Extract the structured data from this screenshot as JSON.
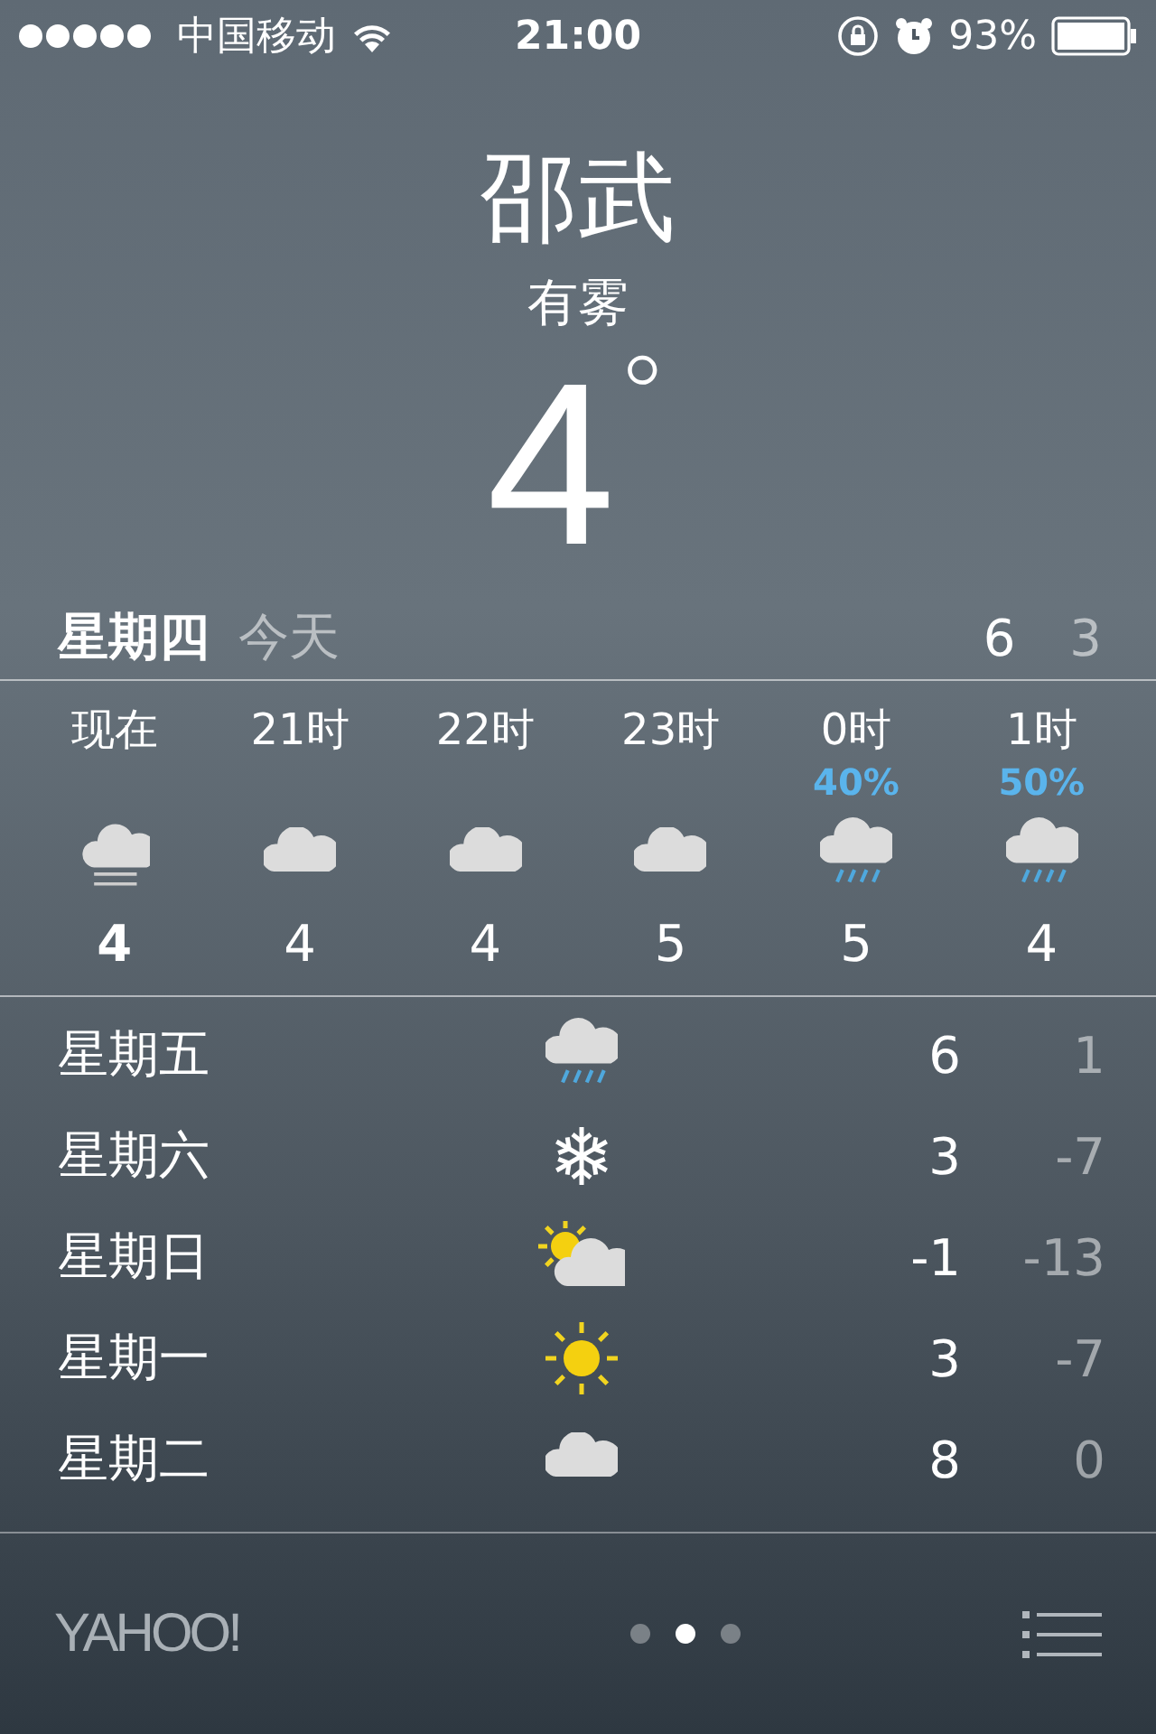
{
  "status_bar": {
    "carrier": "中国移动",
    "time": "21:00",
    "battery": "93%"
  },
  "location": {
    "city": "邵武",
    "condition": "有雾",
    "temperature": "4",
    "degree": "°"
  },
  "today": {
    "day": "星期四",
    "label": "今天",
    "high": "6",
    "low": "3"
  },
  "hourly": [
    {
      "time": "现在",
      "kind": "fog",
      "temp": "4",
      "current": true
    },
    {
      "time": "21时",
      "kind": "cloud",
      "temp": "4",
      "current": false
    },
    {
      "time": "22时",
      "kind": "cloud",
      "temp": "4",
      "current": false
    },
    {
      "time": "23时",
      "kind": "cloud",
      "temp": "5",
      "current": false
    },
    {
      "time": "0时",
      "kind": "rain",
      "chance": "40%",
      "temp": "5",
      "current": false
    },
    {
      "time": "1时",
      "kind": "rain",
      "chance": "50%",
      "temp": "4",
      "current": false
    }
  ],
  "daily": [
    {
      "day": "星期五",
      "kind": "rain",
      "high": "6",
      "low": "1"
    },
    {
      "day": "星期六",
      "kind": "snow",
      "high": "3",
      "low": "-7"
    },
    {
      "day": "星期日",
      "kind": "partly-sunny",
      "high": "-1",
      "low": "-13"
    },
    {
      "day": "星期一",
      "kind": "sun",
      "high": "3",
      "low": "-7"
    },
    {
      "day": "星期二",
      "kind": "cloud",
      "high": "8",
      "low": "0"
    }
  ],
  "footer": {
    "logo": "YAHOO!",
    "pages": [
      {
        "selected": false
      },
      {
        "selected": true
      },
      {
        "selected": false
      }
    ]
  }
}
